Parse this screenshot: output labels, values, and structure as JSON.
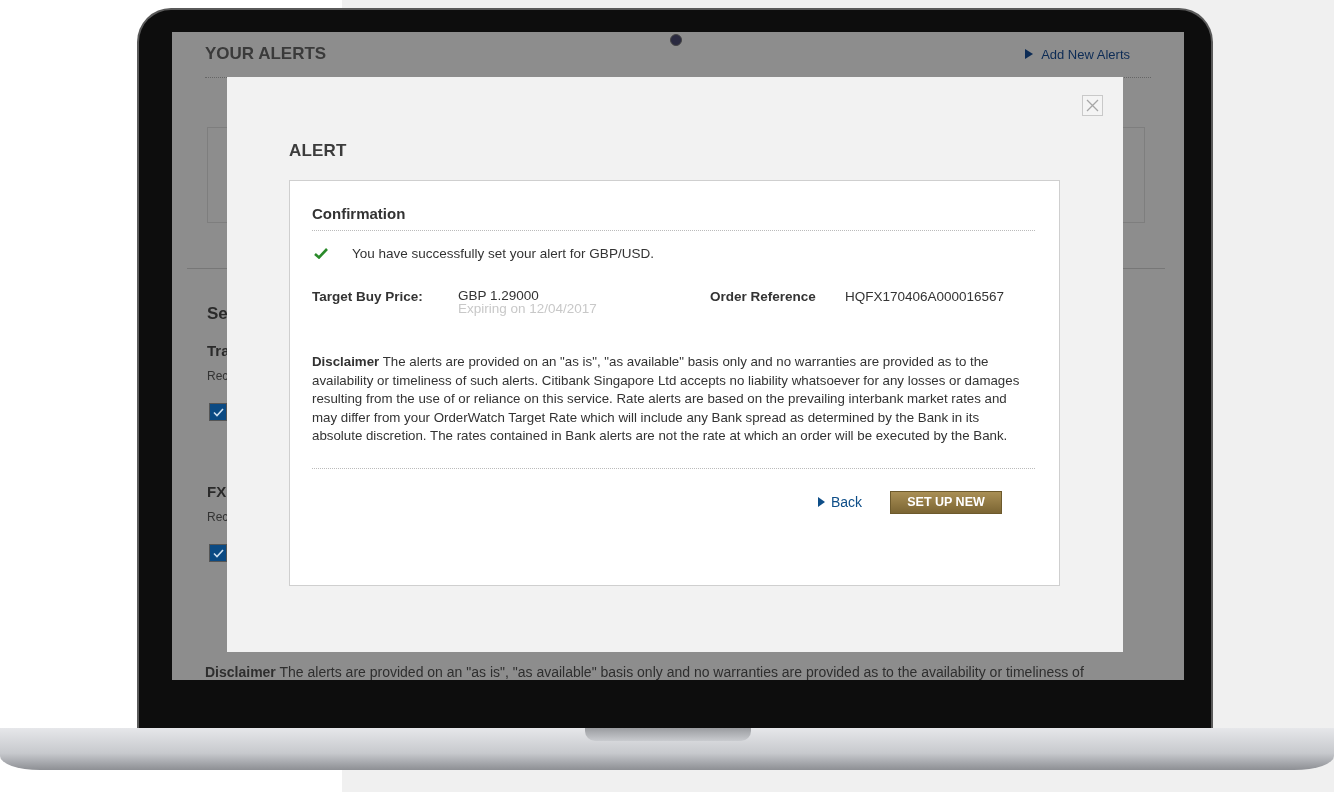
{
  "background_page": {
    "title": "YOUR ALERTS",
    "add_link": "Add New Alerts",
    "section_heading": "Se",
    "groups": [
      {
        "heading": "Tra",
        "note": "Rec",
        "checked": true
      },
      {
        "heading": "FX",
        "note": "Rec",
        "checked": true
      }
    ],
    "disclaimer": "**Disclaimer** The alerts are provided on an \"as is\", \"as available\" basis only and no warranties are provided as to the availability or timeliness of"
  },
  "modal": {
    "title": "ALERT",
    "section_title": "Confirmation",
    "message": "You have successfully set your alert for GBP/USD.",
    "target_label": "Target Buy Price:",
    "target_value": "GBP 1.29000",
    "expiry": "Expiring on 12/04/2017",
    "reference_label": "Order Reference",
    "reference_value": "HQFX170406A000016567",
    "disclaimer": "**Disclaimer** The alerts are provided on an \"as is\", \"as available\" basis only and no warranties are provided as to the availability or timeliness of such alerts. Citibank Singapore Ltd accepts no liability whatsoever for any losses or damages resulting from the use of or reliance on this service. Rate alerts are based on the prevailing interbank market rates and may differ from your OrderWatch Target Rate which will include any Bank spread as determined by the Bank in its absolute discretion. The rates contained in Bank alerts are not the rate at which an order will be executed by the Bank.",
    "back_link": "Back",
    "primary_button": "SET UP NEW"
  }
}
